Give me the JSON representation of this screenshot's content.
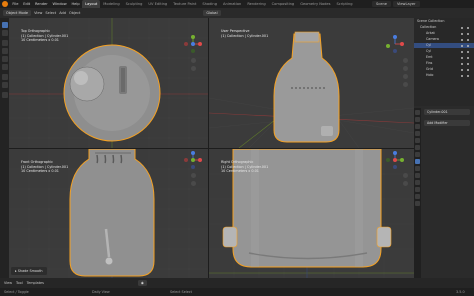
{
  "menu": {
    "items": [
      "File",
      "Edit",
      "Render",
      "Window",
      "Help"
    ],
    "workspaces": [
      "Layout",
      "Modeling",
      "Sculpting",
      "UV Editing",
      "Texture Paint",
      "Shading",
      "Animation",
      "Rendering",
      "Compositing",
      "Geometry Nodes",
      "Scripting"
    ],
    "active_workspace": "Layout",
    "scene": "Scene",
    "view_layer": "ViewLayer"
  },
  "header": {
    "mode": "Object Mode",
    "view": "View",
    "select": "Select",
    "add": "Add",
    "object": "Object",
    "orientation": "Global"
  },
  "viewports": {
    "top_left": {
      "lines": [
        "Top Orthographic",
        "(1) Collection | Cylinder.001",
        "10 Centimeters x 0.01"
      ]
    },
    "top_right": {
      "lines": [
        "User Perspective",
        "(1) Collection | Cylinder.001"
      ]
    },
    "bottom_left": {
      "lines": [
        "Front Orthographic",
        "(1) Collection | Cylinder.001",
        "10 Centimeters x 0.01"
      ]
    },
    "bottom_right": {
      "lines": [
        "Right Orthographic",
        "(1) Collection | Cylinder.001",
        "10 Centimeters x 0.01"
      ]
    }
  },
  "outliner": {
    "title": "Scene Collection",
    "items": [
      {
        "label": "Collection",
        "selected": false
      },
      {
        "label": "Arkat",
        "selected": false
      },
      {
        "label": "Camera",
        "selected": false
      },
      {
        "label": "Cyl",
        "selected": true
      },
      {
        "label": "Cyl",
        "selected": false
      },
      {
        "label": "Emt",
        "selected": false
      },
      {
        "label": "Fins",
        "selected": false
      },
      {
        "label": "Grid",
        "selected": false
      },
      {
        "label": "Holo",
        "selected": false
      }
    ]
  },
  "properties": {
    "object_name": "Cylinder.001",
    "add_modifier": "Add Modifier"
  },
  "operator_panel": {
    "label": "Shade Smooth"
  },
  "timeline": {
    "items": [
      "View",
      "Tool",
      "Templates"
    ]
  },
  "status": {
    "left": "Select / Toggle",
    "middle": "Daily View",
    "middle2": "Select Select",
    "version": "3.5.0"
  },
  "colors": {
    "accent": "#e87d0d",
    "selected": "#4772b3",
    "outline": "#f5a122",
    "x_axis": "#e04a4a",
    "y_axis": "#76b030",
    "z_axis": "#4a7de0"
  }
}
